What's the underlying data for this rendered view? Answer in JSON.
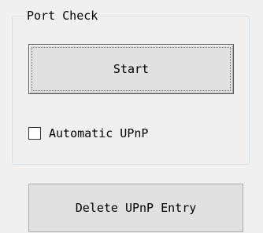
{
  "port_check": {
    "group_title": "Port Check",
    "start_label": "Start",
    "automatic_upnp_label": "Automatic UPnP",
    "automatic_upnp_checked": false
  },
  "delete_upnp_label": "Delete UPnP Entry"
}
